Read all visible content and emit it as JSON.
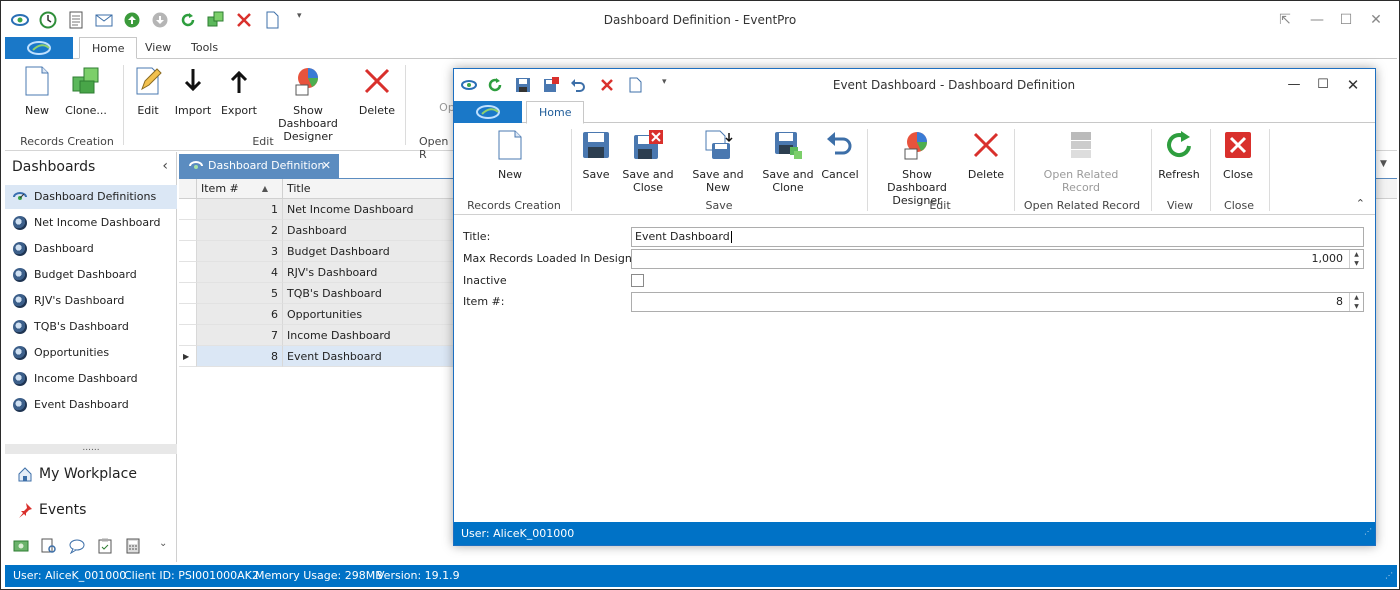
{
  "app": {
    "title": "Dashboard Definition - EventPro",
    "tabs": [
      "Home",
      "View",
      "Tools"
    ],
    "ribbon": {
      "new": "New",
      "clone": "Clone...",
      "edit": "Edit",
      "import": "Import",
      "export": "Export",
      "show_designer": "Show Dashboard Designer",
      "delete": "Delete",
      "open_partial": "Op",
      "groups": {
        "records_creation": "Records Creation",
        "edit": "Edit",
        "open_partial": "Open R"
      }
    }
  },
  "nav": {
    "title": "Dashboards",
    "items": [
      "Dashboard Definitions",
      "Net Income Dashboard",
      "Dashboard",
      "Budget Dashboard",
      "RJV's Dashboard",
      "TQB's Dashboard",
      "Opportunities",
      "Income Dashboard",
      "Event Dashboard"
    ],
    "my_workplace": "My Workplace",
    "events": "Events",
    "grip": "......"
  },
  "doc_tab": {
    "label": "Dashboard Definition"
  },
  "grid": {
    "headers": [
      "Item #",
      "Title"
    ],
    "rows": [
      {
        "item": "1",
        "title": "Net Income Dashboard"
      },
      {
        "item": "2",
        "title": "Dashboard"
      },
      {
        "item": "3",
        "title": "Budget Dashboard"
      },
      {
        "item": "4",
        "title": "RJV's Dashboard"
      },
      {
        "item": "5",
        "title": "TQB's Dashboard"
      },
      {
        "item": "6",
        "title": "Opportunities"
      },
      {
        "item": "7",
        "title": "Income Dashboard"
      },
      {
        "item": "8",
        "title": "Event Dashboard"
      }
    ],
    "selected_row": "8"
  },
  "status": {
    "user": "User: AliceK_001000",
    "client": "Client ID: PSI001000AK2",
    "memory": "Memory Usage: 298MB",
    "version": "Version: 19.1.9"
  },
  "dialog": {
    "title": "Event Dashboard - Dashboard Definition",
    "tab": "Home",
    "ribbon": {
      "new": "New",
      "save": "Save",
      "save_close": "Save and Close",
      "save_new": "Save and New",
      "save_clone": "Save and Clone",
      "cancel": "Cancel",
      "show_designer": "Show Dashboard Designer",
      "delete": "Delete",
      "open_related": "Open Related Record",
      "refresh": "Refresh",
      "close": "Close",
      "groups": {
        "records_creation": "Records Creation",
        "save": "Save",
        "edit": "Edit",
        "open_related": "Open Related Record",
        "view": "View",
        "close": "Close"
      }
    },
    "form": {
      "title_label": "Title:",
      "title_value": "Event Dashboard",
      "max_records_label": "Max Records Loaded In Designer:",
      "max_records_value": "1,000",
      "inactive_label": "Inactive",
      "inactive_checked": false,
      "item_label": "Item #:",
      "item_value": "8"
    },
    "status_user": "User: AliceK_001000"
  },
  "colors": {
    "accent": "#0072c6",
    "selection": "#dbe7f5",
    "doc_tab": "#5b8cc0",
    "delete_red": "#d9302c",
    "refresh_green": "#2e9e3e"
  }
}
